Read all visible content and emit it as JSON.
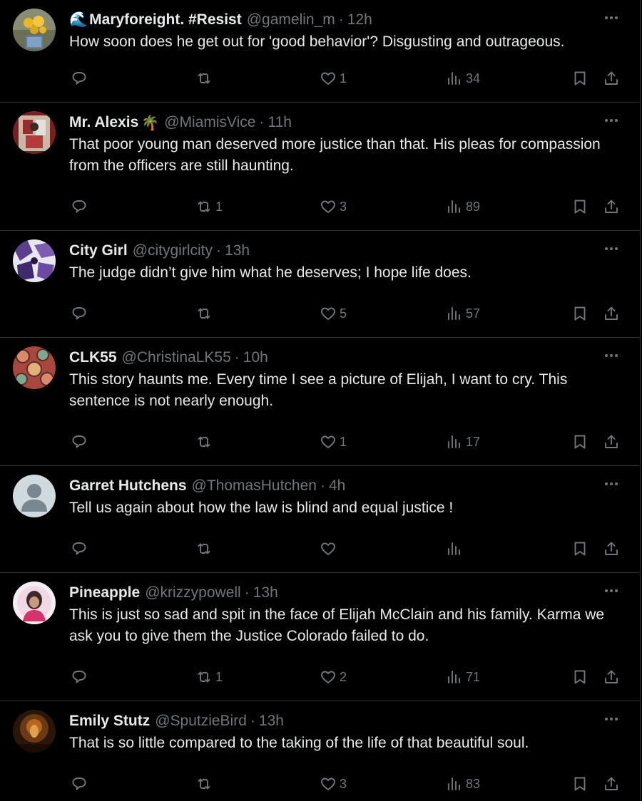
{
  "colors": {
    "background": "#000000",
    "text": "#e7e9ea",
    "muted": "#71767b",
    "divider": "#2f3336"
  },
  "icons": {
    "reply": "reply-icon",
    "retweet": "retweet-icon",
    "like": "heart-icon",
    "views": "views-icon",
    "bookmark": "bookmark-icon",
    "share": "share-icon",
    "more": "more-icon"
  },
  "tweets": [
    {
      "emoji_prefix": "🌊",
      "name": "Maryforeight. #Resist",
      "name_emoji": "",
      "handle": "@gamelin_m",
      "sep": "·",
      "time": "12h",
      "text": "How soon does he get out for 'good behavior'?  Disgusting and outrageous.",
      "replies": "",
      "retweets": "",
      "likes": "1",
      "views": "34"
    },
    {
      "emoji_prefix": "",
      "name": "Mr. Alexis",
      "name_emoji": "🌴",
      "handle": "@MiamisVice",
      "sep": "·",
      "time": "11h",
      "text": "That poor young man deserved more justice than that. His pleas for compassion from the officers are still haunting.",
      "replies": "",
      "retweets": "1",
      "likes": "3",
      "views": "89"
    },
    {
      "emoji_prefix": "",
      "name": "City Girl",
      "name_emoji": "",
      "handle": "@citygirlcity",
      "sep": "·",
      "time": "13h",
      "text": "The judge didn’t give him what he deserves; I hope life does.",
      "replies": "",
      "retweets": "",
      "likes": "5",
      "views": "57"
    },
    {
      "emoji_prefix": "",
      "name": "CLK55",
      "name_emoji": "",
      "handle": "@ChristinaLK55",
      "sep": "·",
      "time": "10h",
      "text": "This story haunts me. Every time I see a picture of Elijah, I want to cry. This sentence is not nearly enough.",
      "replies": "",
      "retweets": "",
      "likes": "1",
      "views": "17"
    },
    {
      "emoji_prefix": "",
      "name": "Garret Hutchens",
      "name_emoji": "",
      "handle": "@ThomasHutchen",
      "sep": "·",
      "time": "4h",
      "text": "Tell us again about how the law is blind and equal justice !",
      "replies": "",
      "retweets": "",
      "likes": "",
      "views": ""
    },
    {
      "emoji_prefix": "",
      "name": "Pineapple",
      "name_emoji": "",
      "handle": "@krizzypowell",
      "sep": "·",
      "time": "13h",
      "text": "This is just so sad and spit in the face of Elijah McClain and his family. Karma we ask you to give them the Justice Colorado failed to do.",
      "replies": "",
      "retweets": "1",
      "likes": "2",
      "views": "71"
    },
    {
      "emoji_prefix": "",
      "name": "Emily Stutz",
      "name_emoji": "",
      "handle": "@SputzieBird",
      "sep": "·",
      "time": "13h",
      "text": "That is so little compared to the taking of the life of that beautiful soul.",
      "replies": "",
      "retweets": "",
      "likes": "3",
      "views": "83"
    }
  ]
}
